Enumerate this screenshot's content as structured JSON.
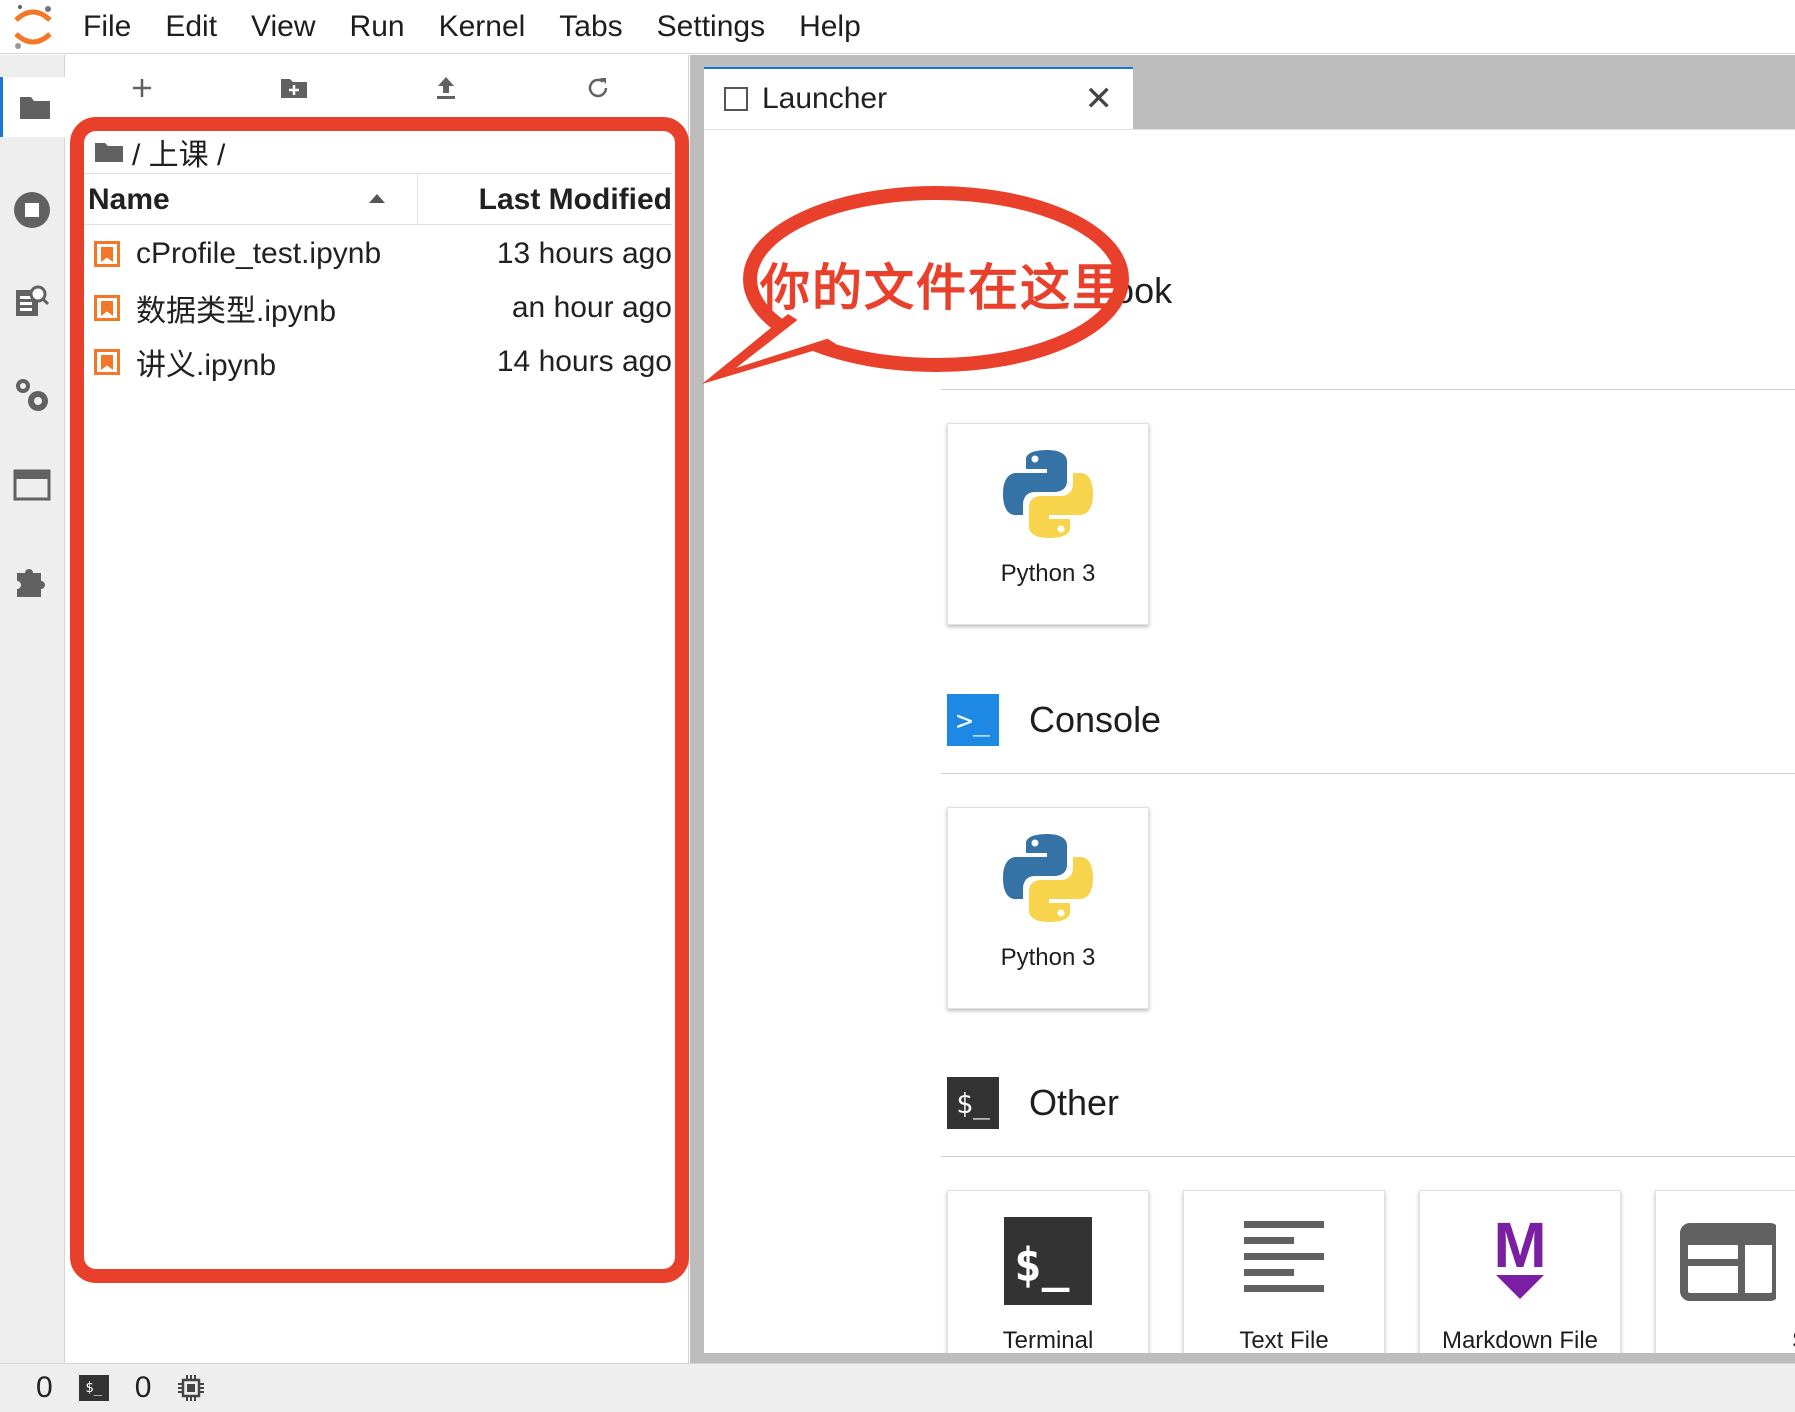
{
  "menubar": {
    "items": [
      "File",
      "Edit",
      "View",
      "Run",
      "Kernel",
      "Tabs",
      "Settings",
      "Help"
    ]
  },
  "sidebar": {
    "icons": [
      "folder-icon",
      "running-icon",
      "property-inspector-icon",
      "settings-gears-icon",
      "tabs-icon",
      "extension-icon"
    ]
  },
  "filebrowser": {
    "toolbar": [
      "new-launcher-icon",
      "new-folder-icon",
      "upload-icon",
      "refresh-icon"
    ],
    "breadcrumb": "/ 上课 /",
    "columns": {
      "name": "Name",
      "modified": "Last Modified"
    },
    "files": [
      {
        "name": "cProfile_test.ipynb",
        "modified": "13 hours ago"
      },
      {
        "name": "数据类型.ipynb",
        "modified": "an hour ago"
      },
      {
        "name": "讲义.ipynb",
        "modified": "14 hours ago"
      }
    ]
  },
  "annotation": {
    "text": "你的文件在这里",
    "color": "#e8402a"
  },
  "tabs": {
    "launcher": {
      "label": "Launcher",
      "close": "✕"
    }
  },
  "launcher": {
    "notebook": {
      "title": "Notebook",
      "visible_title": "tebook",
      "cards": [
        {
          "label": "Python 3"
        }
      ]
    },
    "console": {
      "title": "Console",
      "badge": ">_",
      "badge_color": "#1e88e5",
      "cards": [
        {
          "label": "Python 3"
        }
      ]
    },
    "other": {
      "title": "Other",
      "badge": "$_",
      "badge_color": "#333333",
      "cards": [
        {
          "label": "Terminal"
        },
        {
          "label": "Text File"
        },
        {
          "label": "Markdown File"
        },
        {
          "label": "Show"
        }
      ]
    }
  },
  "statusbar": {
    "kernels": "0",
    "terminals": "0"
  },
  "colors": {
    "accent": "#1976d2",
    "jupyter_orange": "#f37726",
    "markdown_purple": "#7b1fa2"
  }
}
